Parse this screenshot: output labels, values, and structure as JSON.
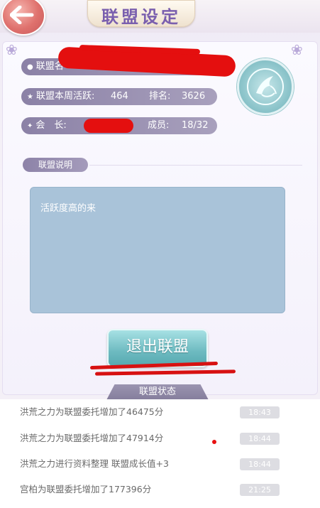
{
  "page_title": "联盟设定",
  "info": {
    "name_label": "联盟名",
    "activity_label": "联盟本周活跃:",
    "activity_value": "464",
    "rank_label": "排名:",
    "rank_value": "3626",
    "leader_label": "会　长:",
    "members_label": "成员:",
    "members_value": "18/32"
  },
  "description": {
    "label": "联盟说明",
    "text": "活跃度高的来"
  },
  "quit_button": "退出联盟",
  "status": {
    "title": "联盟状态",
    "logs": [
      {
        "text": "洪荒之力为联盟委托增加了46475分",
        "time": "18:43"
      },
      {
        "text": "洪荒之力为联盟委托增加了47914分",
        "time": "18:44"
      },
      {
        "text": "洪荒之力进行资料整理 联盟成长值+3",
        "time": "18:44"
      },
      {
        "text": "宫柏为联盟委托增加了177396分",
        "time": "21:25"
      }
    ]
  },
  "icons": {
    "back": "back-arrow-icon",
    "emblem": "phoenix-emblem-icon"
  }
}
